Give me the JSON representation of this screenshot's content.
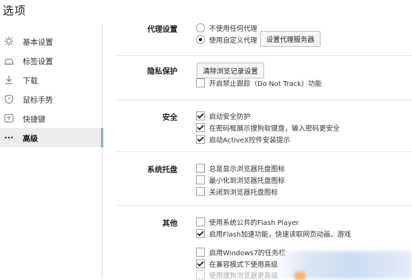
{
  "window": {
    "title": "选项"
  },
  "sidebar": {
    "items": [
      {
        "label": "基本设置",
        "icon": "gear-icon",
        "active": false
      },
      {
        "label": "标签设置",
        "icon": "tab-icon",
        "active": false
      },
      {
        "label": "下载",
        "icon": "download-icon",
        "active": false
      },
      {
        "label": "鼠标手势",
        "icon": "shield-icon",
        "active": false
      },
      {
        "label": "快捷键",
        "icon": "keyboard-icon",
        "active": false
      },
      {
        "label": "高级",
        "icon": "more-icon",
        "active": true
      }
    ]
  },
  "proxy": {
    "label": "代理设置",
    "options": [
      {
        "label": "不使用任何代理",
        "selected": false
      },
      {
        "label": "使用自定义代理",
        "selected": true
      }
    ],
    "button": "设置代理服务器"
  },
  "privacy": {
    "label": "隐私保护",
    "button": "清除浏览记录设置",
    "dnt": {
      "label": "开启禁止跟踪（Do Not Track）功能",
      "checked": false
    }
  },
  "security": {
    "label": "安全",
    "items": [
      {
        "label": "启动安全防护",
        "checked": true
      },
      {
        "label": "在密码框展示搜狗软键盘，输入密码更安全",
        "checked": true
      },
      {
        "label": "启动ActiveX控件安装提示",
        "checked": true
      }
    ]
  },
  "tray": {
    "label": "系统托盘",
    "items": [
      {
        "label": "总是显示浏览器托盘图标",
        "checked": false
      },
      {
        "label": "最小化到浏览器托盘图标",
        "checked": false
      },
      {
        "label": "关闭到浏览器托盘图标",
        "checked": false
      }
    ]
  },
  "other": {
    "label": "其他",
    "items": [
      {
        "label": "使用系统公共的Flash Player",
        "checked": false
      },
      {
        "label": "启用Flash加速功能，快速读取网页动画、游戏",
        "checked": true
      },
      {
        "label": "启用Windows7的任务栏",
        "checked": false
      },
      {
        "label": "在兼容模式下使用高级",
        "checked": true
      },
      {
        "label": "使用搜狗浏览器更高级",
        "checked": false,
        "disabled": true
      }
    ]
  }
}
